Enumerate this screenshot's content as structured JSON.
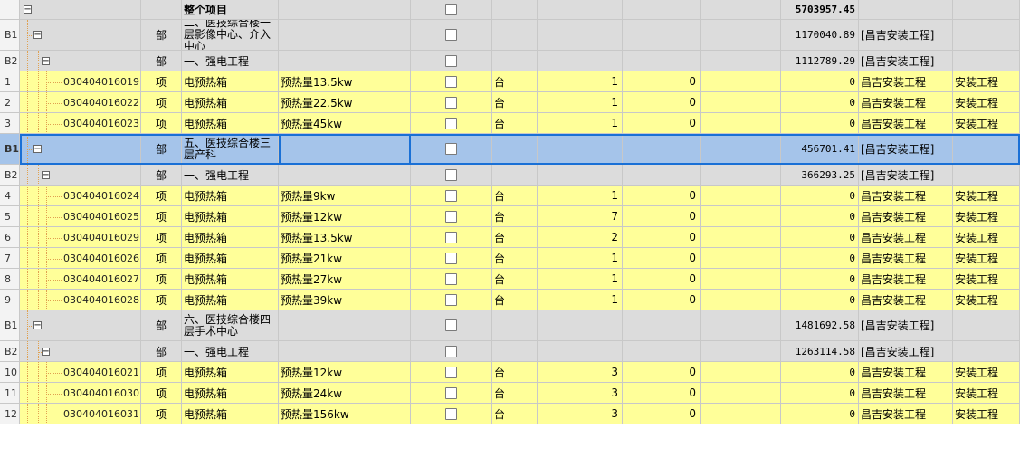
{
  "grid": {
    "top_row": {
      "label": "整个项目",
      "amount": "5703957.45"
    },
    "rows": [
      {
        "kind": "B1",
        "rn": "B1",
        "unit": "部",
        "name": "二、医技综合楼一层影像中心、介入中心",
        "amount": "1170040.89",
        "proj": "[昌吉安装工程]"
      },
      {
        "kind": "B2",
        "rn": "B2",
        "unit": "部",
        "name": "一、强电工程",
        "amount": "1112789.29",
        "proj": "[昌吉安装工程]"
      },
      {
        "kind": "item",
        "rn": "1",
        "code": "030404016019",
        "unit": "项",
        "name": "电预热箱",
        "desc": "预热量13.5kw",
        "u2": "台",
        "qty": "1",
        "price": "0",
        "amount": "0",
        "proj": "昌吉安装工程",
        "sp": "安装工程"
      },
      {
        "kind": "item",
        "rn": "2",
        "code": "030404016022",
        "unit": "项",
        "name": "电预热箱",
        "desc": "预热量22.5kw",
        "u2": "台",
        "qty": "1",
        "price": "0",
        "amount": "0",
        "proj": "昌吉安装工程",
        "sp": "安装工程"
      },
      {
        "kind": "item",
        "rn": "3",
        "code": "030404016023",
        "unit": "项",
        "name": "电预热箱",
        "desc": "预热量45kw",
        "u2": "台",
        "qty": "1",
        "price": "0",
        "amount": "0",
        "proj": "昌吉安装工程",
        "sp": "安装工程"
      },
      {
        "kind": "sel",
        "rn": "B1",
        "unit": "部",
        "name": "五、医技综合楼三层产科",
        "amount": "456701.41",
        "proj": "[昌吉安装工程]"
      },
      {
        "kind": "B2",
        "rn": "B2",
        "unit": "部",
        "name": "一、强电工程",
        "amount": "366293.25",
        "proj": "[昌吉安装工程]"
      },
      {
        "kind": "item",
        "rn": "4",
        "code": "030404016024",
        "unit": "项",
        "name": "电预热箱",
        "desc": "预热量9kw",
        "u2": "台",
        "qty": "1",
        "price": "0",
        "amount": "0",
        "proj": "昌吉安装工程",
        "sp": "安装工程"
      },
      {
        "kind": "item",
        "rn": "5",
        "code": "030404016025",
        "unit": "项",
        "name": "电预热箱",
        "desc": "预热量12kw",
        "u2": "台",
        "qty": "7",
        "price": "0",
        "amount": "0",
        "proj": "昌吉安装工程",
        "sp": "安装工程"
      },
      {
        "kind": "item",
        "rn": "6",
        "code": "030404016029",
        "unit": "项",
        "name": "电预热箱",
        "desc": "预热量13.5kw",
        "u2": "台",
        "qty": "2",
        "price": "0",
        "amount": "0",
        "proj": "昌吉安装工程",
        "sp": "安装工程"
      },
      {
        "kind": "item",
        "rn": "7",
        "code": "030404016026",
        "unit": "项",
        "name": "电预热箱",
        "desc": "预热量21kw",
        "u2": "台",
        "qty": "1",
        "price": "0",
        "amount": "0",
        "proj": "昌吉安装工程",
        "sp": "安装工程"
      },
      {
        "kind": "item",
        "rn": "8",
        "code": "030404016027",
        "unit": "项",
        "name": "电预热箱",
        "desc": "预热量27kw",
        "u2": "台",
        "qty": "1",
        "price": "0",
        "amount": "0",
        "proj": "昌吉安装工程",
        "sp": "安装工程"
      },
      {
        "kind": "item",
        "rn": "9",
        "code": "030404016028",
        "unit": "项",
        "name": "电预热箱",
        "desc": "预热量39kw",
        "u2": "台",
        "qty": "1",
        "price": "0",
        "amount": "0",
        "proj": "昌吉安装工程",
        "sp": "安装工程"
      },
      {
        "kind": "B1",
        "rn": "B1",
        "unit": "部",
        "name": "六、医技综合楼四层手术中心",
        "amount": "1481692.58",
        "proj": "[昌吉安装工程]"
      },
      {
        "kind": "B2",
        "rn": "B2",
        "unit": "部",
        "name": "一、强电工程",
        "amount": "1263114.58",
        "proj": "[昌吉安装工程]"
      },
      {
        "kind": "item",
        "rn": "10",
        "code": "030404016021",
        "unit": "项",
        "name": "电预热箱",
        "desc": "预热量12kw",
        "u2": "台",
        "qty": "3",
        "price": "0",
        "amount": "0",
        "proj": "昌吉安装工程",
        "sp": "安装工程"
      },
      {
        "kind": "item",
        "rn": "11",
        "code": "030404016030",
        "unit": "项",
        "name": "电预热箱",
        "desc": "预热量24kw",
        "u2": "台",
        "qty": "3",
        "price": "0",
        "amount": "0",
        "proj": "昌吉安装工程",
        "sp": "安装工程"
      },
      {
        "kind": "item",
        "rn": "12",
        "code": "030404016031",
        "unit": "项",
        "name": "电预热箱",
        "desc": "预热量156kw",
        "u2": "台",
        "qty": "3",
        "price": "0",
        "amount": "0",
        "proj": "昌吉安装工程",
        "sp": "安装工程"
      }
    ]
  },
  "colors": {
    "item_bg": "#ffff99",
    "group_bg": "#dcdcdc",
    "selected_bg": "#a5c4ea",
    "selected_border": "#1a70d6",
    "tree_line": "#e0a050"
  },
  "icons": {
    "collapse": "minus-box-icon"
  }
}
